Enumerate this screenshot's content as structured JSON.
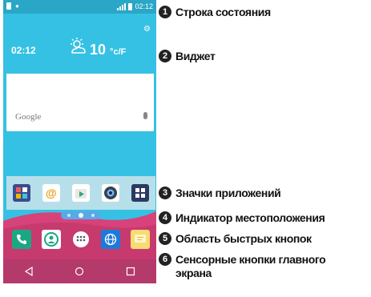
{
  "status_bar": {
    "time": "02:12"
  },
  "widget": {
    "time": "02:12",
    "temperature": "10",
    "unit": "°c/F"
  },
  "search": {
    "placeholder": "Google"
  },
  "app_icons": [
    "contacts-icon",
    "email-icon",
    "play-store-icon",
    "camera-icon",
    "apps-folder-icon"
  ],
  "quick_buttons": [
    "phone-icon",
    "contacts-icon",
    "apps-icon",
    "browser-icon",
    "messaging-icon"
  ],
  "nav_buttons": [
    "back-icon",
    "home-icon",
    "recent-icon"
  ],
  "callouts": [
    {
      "number": "1",
      "label": "Строка состояния"
    },
    {
      "number": "2",
      "label": "Виджет"
    },
    {
      "number": "3",
      "label": "Значки приложений"
    },
    {
      "number": "4",
      "label": "Индикатор местоположения"
    },
    {
      "number": "5",
      "label": "Область быстрых кнопок"
    },
    {
      "number": "6",
      "label": "Сенсорные кнопки главного экрана"
    }
  ],
  "colors": {
    "screen_bg": "#35c1e4",
    "navbar": "#b43a6b",
    "wave": "#d8427a",
    "callout_badge": "#222222"
  }
}
